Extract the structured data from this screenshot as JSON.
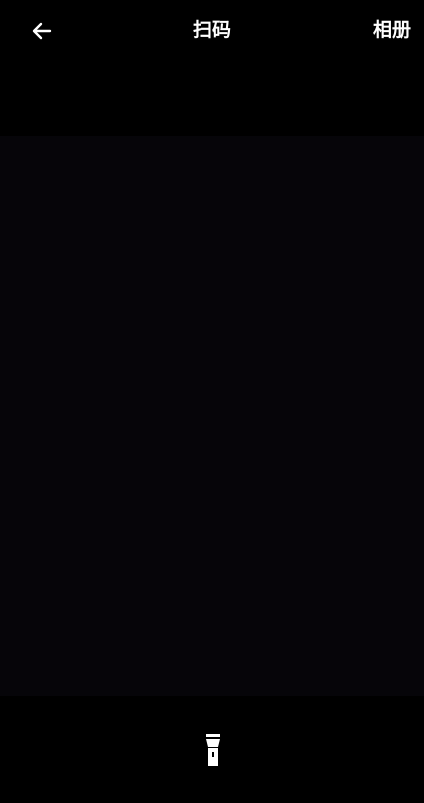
{
  "header": {
    "back_icon": "arrow-left-icon",
    "title": "扫码",
    "album_label": "相册"
  },
  "scanner": {
    "background_color": "#060509"
  },
  "footer": {
    "torch_icon": "flashlight-icon"
  }
}
